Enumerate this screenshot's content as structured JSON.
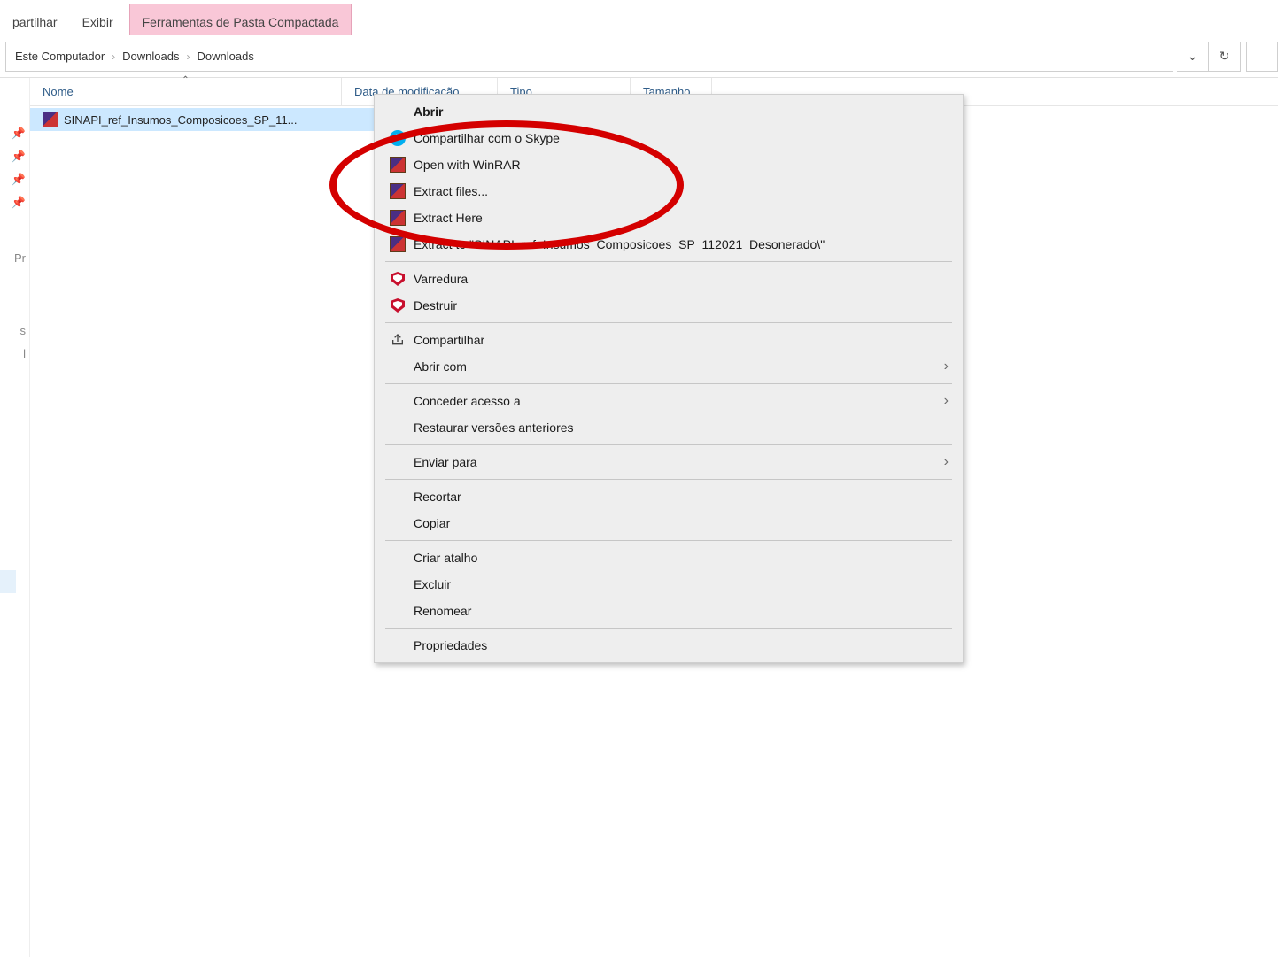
{
  "ribbon": {
    "tab_share": "partilhar",
    "tab_view": "Exibir",
    "tab_compressed": "Ferramentas de Pasta Compactada"
  },
  "breadcrumb": {
    "seg1": "Este Computador",
    "seg2": "Downloads",
    "seg3": "Downloads"
  },
  "columns": {
    "name": "Nome",
    "date": "Data de modificação",
    "type": "Tipo",
    "size": "Tamanho"
  },
  "file": {
    "name": "SINAPI_ref_Insumos_Composicoes_SP_11..."
  },
  "sidebar": {
    "stub_pr": "Pr",
    "stub_s": "s",
    "stub_l": "l"
  },
  "ctx": {
    "open": "Abrir",
    "skype": "Compartilhar com o Skype",
    "open_winrar": "Open with WinRAR",
    "extract_files": "Extract files...",
    "extract_here": "Extract Here",
    "extract_to": "Extract to \"SINAPI_ref_Insumos_Composicoes_SP_112021_Desonerado\\\"",
    "varredura": "Varredura",
    "destruir": "Destruir",
    "compartilhar": "Compartilhar",
    "abrir_com": "Abrir com",
    "conceder": "Conceder acesso a",
    "restaurar": "Restaurar versões anteriores",
    "enviar": "Enviar para",
    "recortar": "Recortar",
    "copiar": "Copiar",
    "atalho": "Criar atalho",
    "excluir": "Excluir",
    "renomear": "Renomear",
    "propriedades": "Propriedades"
  }
}
